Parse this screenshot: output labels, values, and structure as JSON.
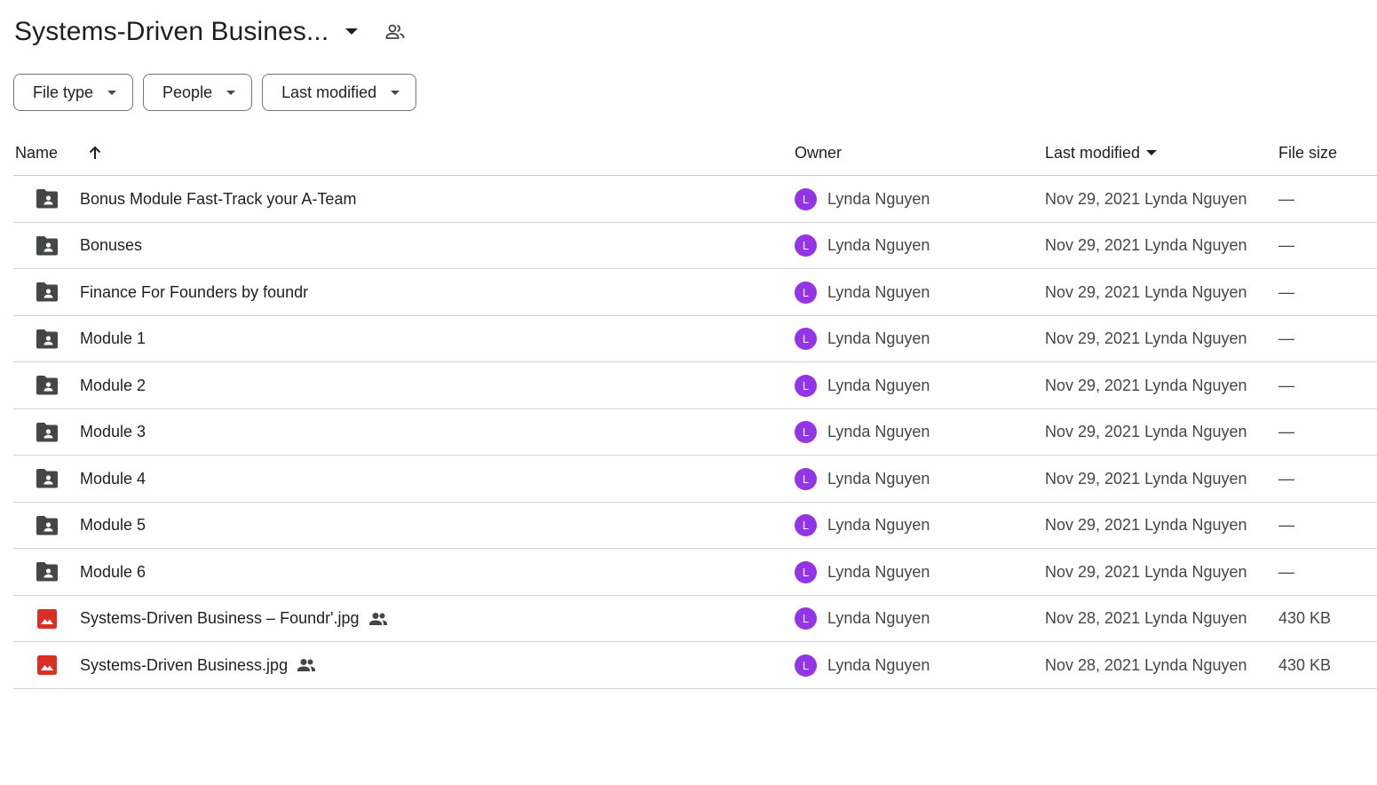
{
  "header": {
    "title": "Systems-Driven Busines...",
    "colors": {
      "folder": "#444746",
      "image": "#d93025",
      "avatar": "#9334e6"
    }
  },
  "filters": [
    {
      "label": "File type"
    },
    {
      "label": "People"
    },
    {
      "label": "Last modified"
    }
  ],
  "columns": {
    "name": "Name",
    "owner": "Owner",
    "last_modified": "Last modified",
    "file_size": "File size"
  },
  "rows": [
    {
      "icon": "shared-folder-icon",
      "name": "Bonus Module Fast-Track your A-Team",
      "shared": false,
      "owner_initial": "L",
      "owner": "Lynda Nguyen",
      "modified": "Nov 29, 2021 Lynda Nguyen",
      "size": "—"
    },
    {
      "icon": "shared-folder-icon",
      "name": "Bonuses",
      "shared": false,
      "owner_initial": "L",
      "owner": "Lynda Nguyen",
      "modified": "Nov 29, 2021 Lynda Nguyen",
      "size": "—"
    },
    {
      "icon": "shared-folder-icon",
      "name": "Finance For Founders by foundr",
      "shared": false,
      "owner_initial": "L",
      "owner": "Lynda Nguyen",
      "modified": "Nov 29, 2021 Lynda Nguyen",
      "size": "—"
    },
    {
      "icon": "shared-folder-icon",
      "name": "Module 1",
      "shared": false,
      "owner_initial": "L",
      "owner": "Lynda Nguyen",
      "modified": "Nov 29, 2021 Lynda Nguyen",
      "size": "—"
    },
    {
      "icon": "shared-folder-icon",
      "name": "Module 2",
      "shared": false,
      "owner_initial": "L",
      "owner": "Lynda Nguyen",
      "modified": "Nov 29, 2021 Lynda Nguyen",
      "size": "—"
    },
    {
      "icon": "shared-folder-icon",
      "name": "Module 3",
      "shared": false,
      "owner_initial": "L",
      "owner": "Lynda Nguyen",
      "modified": "Nov 29, 2021 Lynda Nguyen",
      "size": "—"
    },
    {
      "icon": "shared-folder-icon",
      "name": "Module 4",
      "shared": false,
      "owner_initial": "L",
      "owner": "Lynda Nguyen",
      "modified": "Nov 29, 2021 Lynda Nguyen",
      "size": "—"
    },
    {
      "icon": "shared-folder-icon",
      "name": "Module 5",
      "shared": false,
      "owner_initial": "L",
      "owner": "Lynda Nguyen",
      "modified": "Nov 29, 2021 Lynda Nguyen",
      "size": "—"
    },
    {
      "icon": "shared-folder-icon",
      "name": "Module 6",
      "shared": false,
      "owner_initial": "L",
      "owner": "Lynda Nguyen",
      "modified": "Nov 29, 2021 Lynda Nguyen",
      "size": "—"
    },
    {
      "icon": "image-file-icon",
      "name": "Systems-Driven Business – Foundr'.jpg",
      "shared": true,
      "owner_initial": "L",
      "owner": "Lynda Nguyen",
      "modified": "Nov 28, 2021 Lynda Nguyen",
      "size": "430 KB"
    },
    {
      "icon": "image-file-icon",
      "name": "Systems-Driven Business.jpg",
      "shared": true,
      "owner_initial": "L",
      "owner": "Lynda Nguyen",
      "modified": "Nov 28, 2021 Lynda Nguyen",
      "size": "430 KB"
    }
  ]
}
